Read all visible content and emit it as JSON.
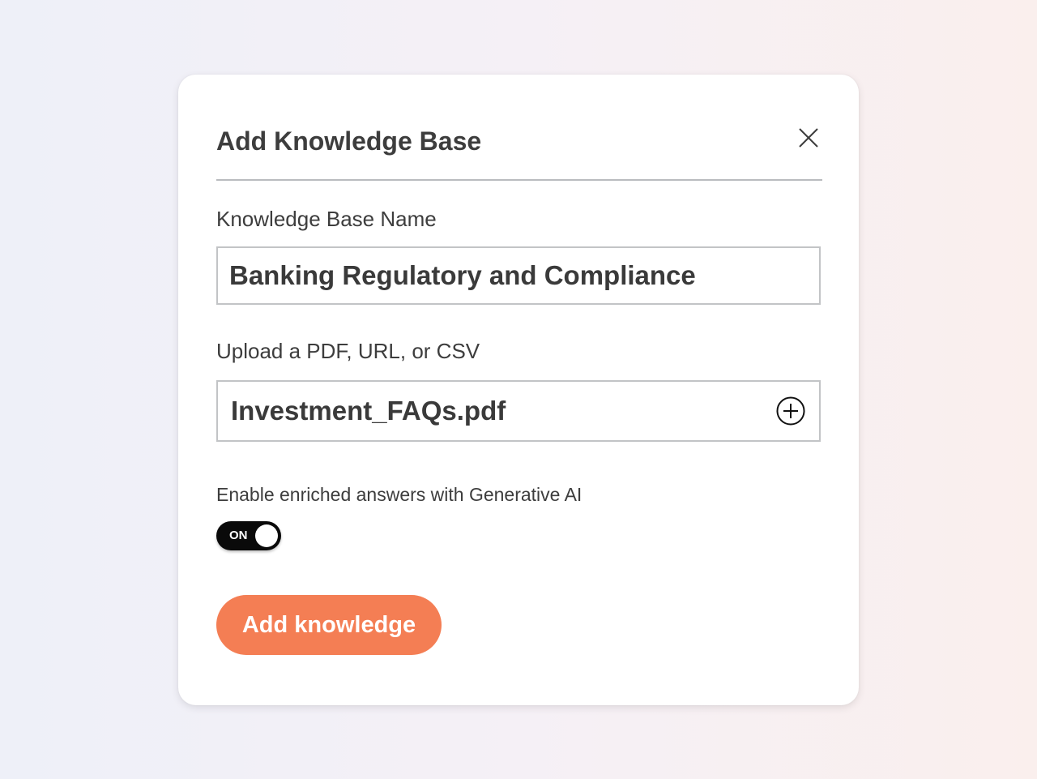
{
  "modal": {
    "title": "Add Knowledge Base",
    "close_icon": "close-icon"
  },
  "name_field": {
    "label": "Knowledge Base Name",
    "value": "Banking Regulatory and Compliance"
  },
  "upload_field": {
    "label": "Upload a PDF, URL, or CSV",
    "value": "Investment_FAQs.pdf",
    "add_icon": "plus-circle-icon"
  },
  "gen_ai_toggle": {
    "label": "Enable enriched answers with Generative AI",
    "state_text": "ON"
  },
  "submit": {
    "label": "Add knowledge"
  },
  "colors": {
    "accent": "#f47e54",
    "toggle_on": "#0a0a0a",
    "text": "#3d3d3d"
  }
}
